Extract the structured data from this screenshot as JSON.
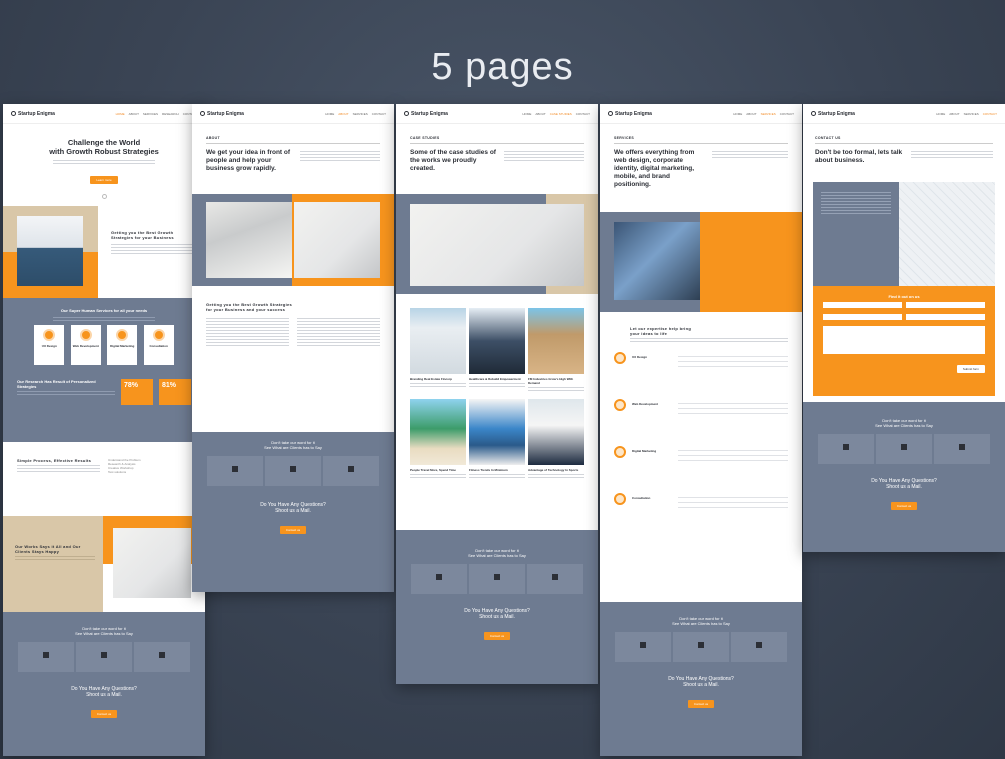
{
  "headline": "5 pages",
  "brand": "Startup Enigma",
  "nav": [
    "HOME",
    "ABOUT",
    "SERVICES",
    "RESEARCH",
    "CASE STUDIES",
    "CONTACT"
  ],
  "page1": {
    "hero_title_1": "Challenge the World",
    "hero_title_2": "with Growth Robust Strategies",
    "hero_button": "Learn more",
    "intro_title": "Getting you the Best Growth Strategies for your Business",
    "services_title": "Our Super Human Services for all your needs",
    "services": [
      "UX Design",
      "Web Development",
      "Digital Marketing",
      "Consultation"
    ],
    "stats_title": "Our Research Has Result of Personalized Strategies",
    "stat_1": "78%",
    "stat_2": "81%",
    "process_title": "Simple Process, Effective Results",
    "process_steps": [
      "Understand the Problem",
      "Research & Analysis",
      "Creative Workshop",
      "Test solutions"
    ],
    "case_title": "Our Works Says it All and Our Clients Stays Happy",
    "testimonials_title": "Don't take our word for it",
    "testimonials_sub": "See What are Clients has to Say",
    "cta_1": "Do You Have Any Questions?",
    "cta_2": "Shoot us a Mail.",
    "cta_button": "Contact us"
  },
  "page2": {
    "label": "ABOUT",
    "title": "We get your idea in front of people and help your business grow rapidly.",
    "section_title": "Getting you the Best Growth Strategies for your Business and your success",
    "testimonials_title": "Don't take our word for it",
    "testimonials_sub": "See What are Clients has to Say",
    "cta_1": "Do You Have Any Questions?",
    "cta_2": "Shoot us a Mail.",
    "cta_button": "Contact us"
  },
  "page3": {
    "label": "CASE STUDIES",
    "title": "Some of the case studies of the works we proudly created.",
    "cases": [
      "Branding Real Estate Fincorp",
      "Healthcare & Rebuild Empowerment",
      "FM Industries Grow's High With Demand",
      "People Travel More, Spend Time",
      "Fitness Trends In Minimum",
      "Advantage of Technology In Sports"
    ],
    "testimonials_title": "Don't take our word for it",
    "testimonials_sub": "See What are Clients has to Say",
    "cta_1": "Do You Have Any Questions?",
    "cta_2": "Shoot us a Mail.",
    "cta_button": "Contact us"
  },
  "page4": {
    "label": "SERVICES",
    "title": "We offers everything from web design, corporate identity, digital marketing, mobile, and brand positioning.",
    "expertise_title": "Let our expertise help bring your ideas to life",
    "services": [
      "UX Design",
      "Web Development",
      "Digital Marketing",
      "Consultation"
    ],
    "testimonials_title": "Don't take our word for it",
    "testimonials_sub": "See What are Clients has to Say",
    "cta_1": "Do You Have Any Questions?",
    "cta_2": "Shoot us a Mail.",
    "cta_button": "Contact us"
  },
  "page5": {
    "label": "CONTACT US",
    "title": "Don't be too formal, lets talk about business.",
    "form_title": "Find it out on us",
    "form_button": "Submit form",
    "testimonials_title": "Don't take our word for it",
    "testimonials_sub": "See What are Clients has to Say",
    "cta_1": "Do You Have Any Questions?",
    "cta_2": "Shoot us a Mail.",
    "cta_button": "Contact us"
  },
  "colors": {
    "accent": "#f7941d",
    "slate": "#6e7b91",
    "tan": "#d9c7a8",
    "background": "#3a4454"
  }
}
